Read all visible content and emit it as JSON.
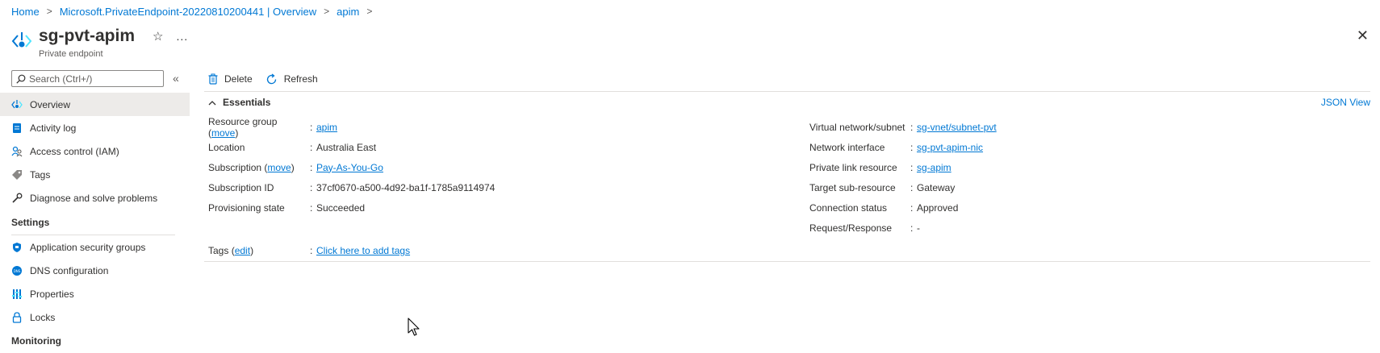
{
  "breadcrumb": [
    {
      "label": "Home"
    },
    {
      "label": "Microsoft.PrivateEndpoint-20220810200441 | Overview"
    },
    {
      "label": "apim"
    }
  ],
  "header": {
    "title": "sg-pvt-apim",
    "subtitle": "Private endpoint",
    "favorite_icon": "star-icon",
    "more_label": "...",
    "close_label": "✕"
  },
  "search": {
    "placeholder": "Search (Ctrl+/)",
    "value": ""
  },
  "sidebar": {
    "collapse_label": "«",
    "items": [
      {
        "label": "Overview",
        "icon": "private-endpoint-icon"
      },
      {
        "label": "Activity log",
        "icon": "activity-log-icon"
      },
      {
        "label": "Access control (IAM)",
        "icon": "iam-people-icon"
      },
      {
        "label": "Tags",
        "icon": "tag-icon"
      },
      {
        "label": "Diagnose and solve problems",
        "icon": "wrench-icon"
      }
    ],
    "settings_title": "Settings",
    "settings_items": [
      {
        "label": "Application security groups",
        "icon": "shield-icon"
      },
      {
        "label": "DNS configuration",
        "icon": "dns-icon"
      },
      {
        "label": "Properties",
        "icon": "properties-icon"
      },
      {
        "label": "Locks",
        "icon": "lock-icon"
      }
    ],
    "monitoring_title": "Monitoring"
  },
  "toolbar": {
    "delete_label": "Delete",
    "refresh_label": "Refresh"
  },
  "essentials": {
    "title": "Essentials",
    "json_view_label": "JSON View",
    "move_label": "move",
    "left": {
      "resource_group_label": "Resource group",
      "resource_group_value": "apim",
      "location_label": "Location",
      "location_value": "Australia East",
      "subscription_label": "Subscription",
      "subscription_value": "Pay-As-You-Go",
      "subscription_id_label": "Subscription ID",
      "subscription_id_value": "37cf0670-a500-4d92-ba1f-1785a9114974",
      "provisioning_label": "Provisioning state",
      "provisioning_value": "Succeeded"
    },
    "right": {
      "vnet_label": "Virtual network/subnet",
      "vnet_value": "sg-vnet/subnet-pvt",
      "nic_label": "Network interface",
      "nic_value": "sg-pvt-apim-nic",
      "plr_label": "Private link resource",
      "plr_value": "sg-apim",
      "target_label": "Target sub-resource",
      "target_value": "Gateway",
      "conn_label": "Connection status",
      "conn_value": "Approved",
      "req_label": "Request/Response",
      "req_value": "-"
    },
    "tags_label": "Tags",
    "tags_edit_label": "edit",
    "tags_value": "Click here to add tags",
    "colon": ":"
  }
}
